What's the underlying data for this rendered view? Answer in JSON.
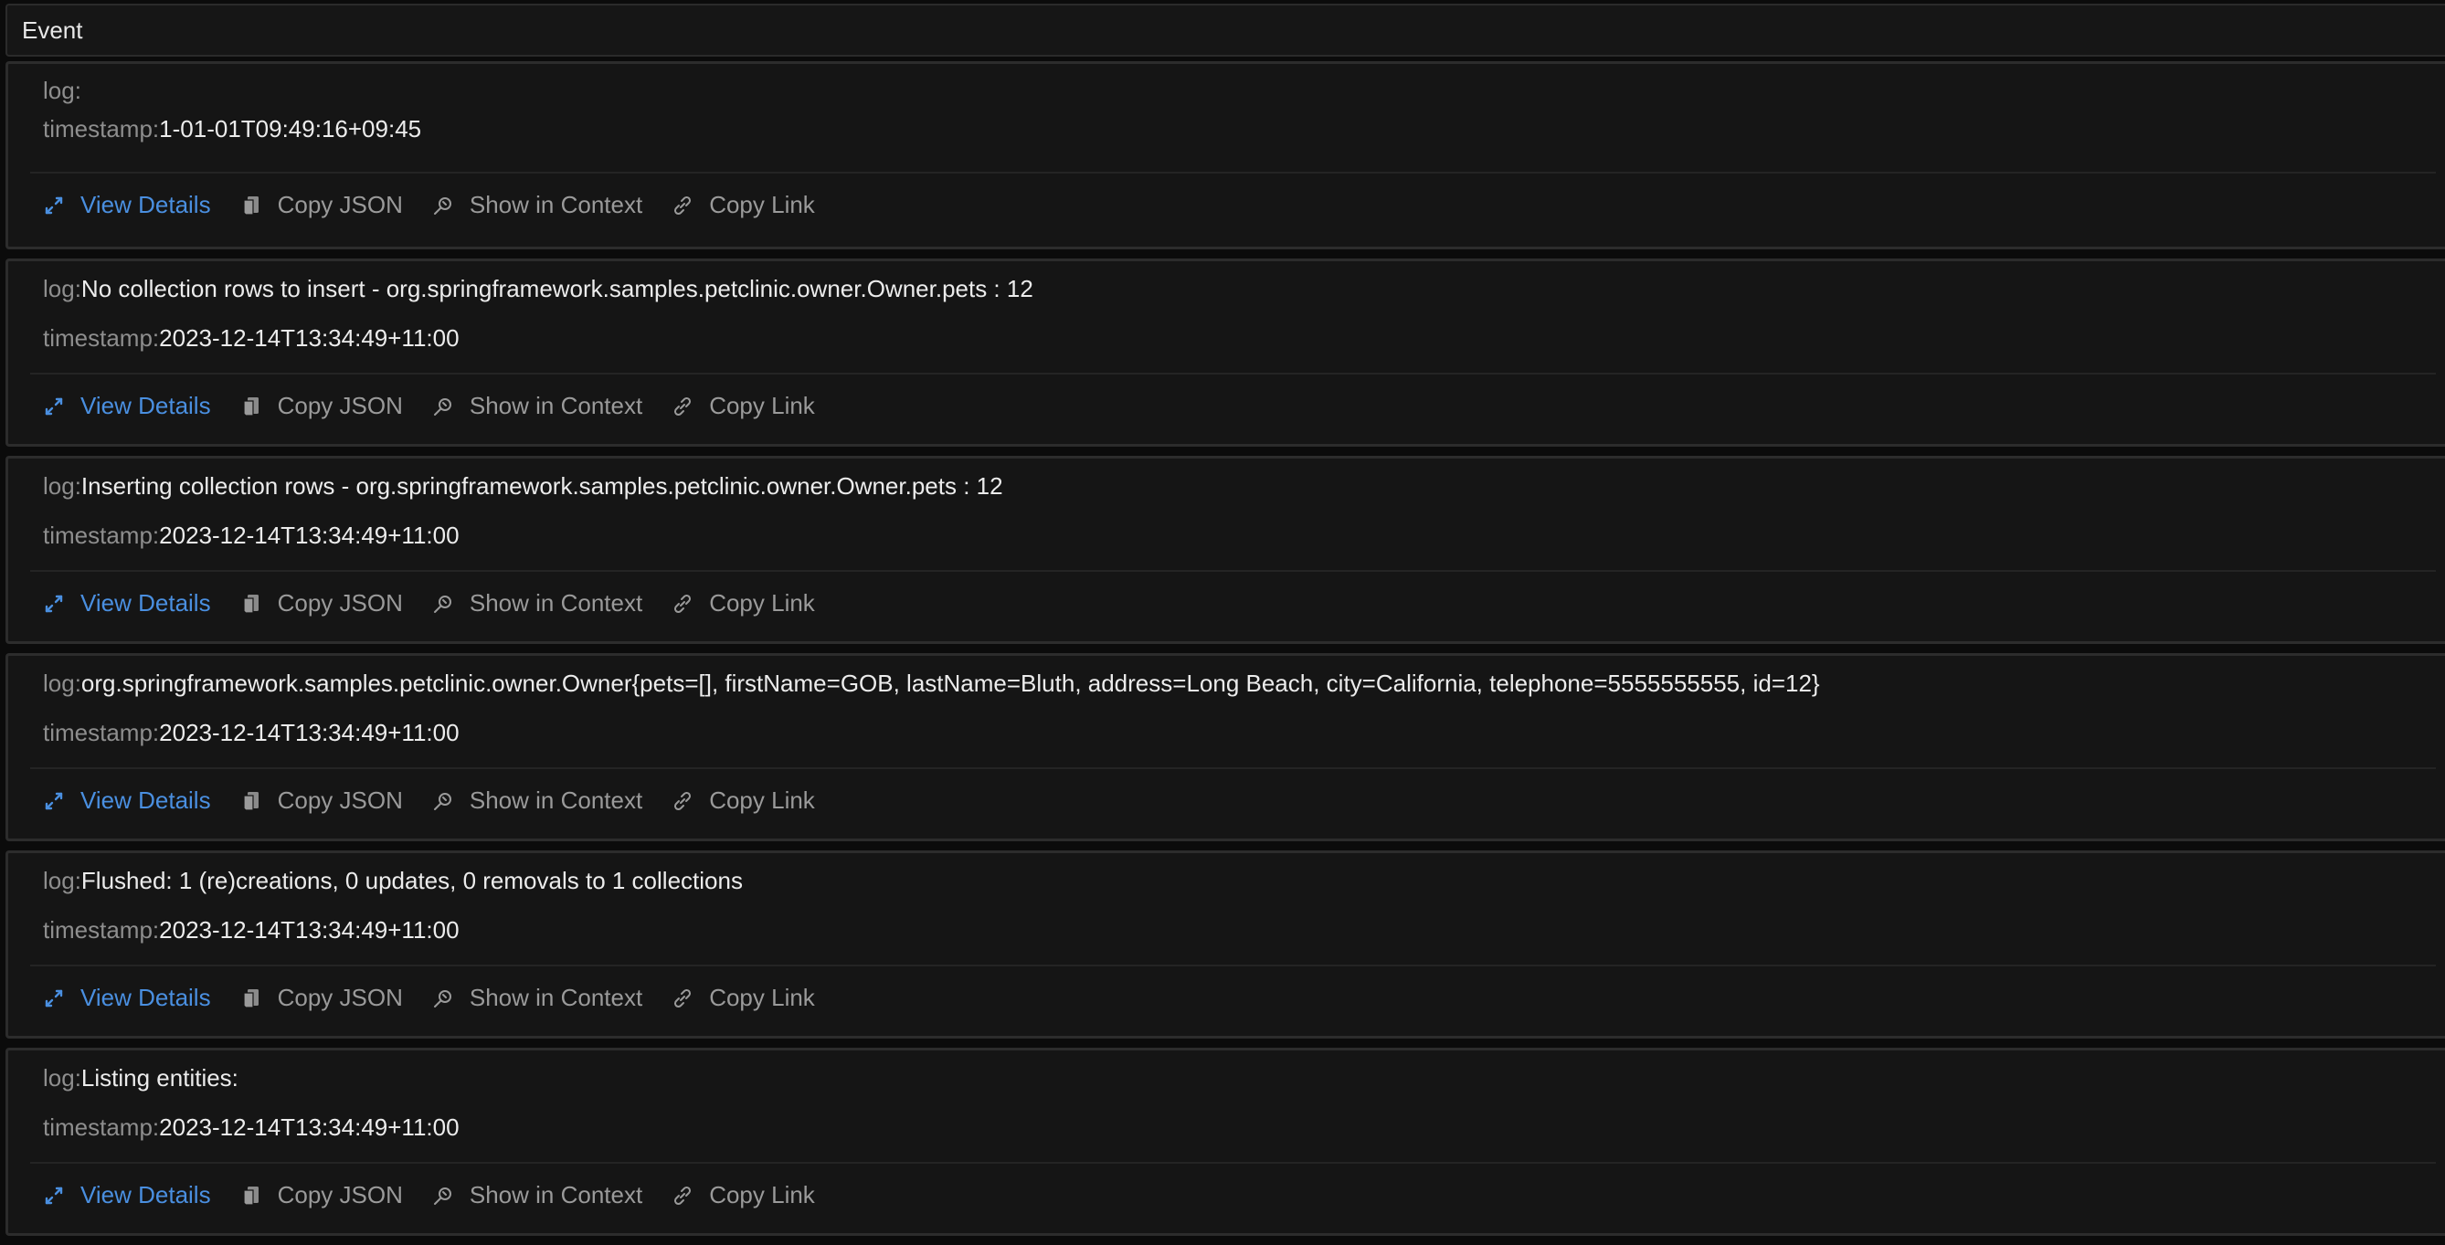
{
  "header": {
    "title": "Event"
  },
  "field_labels": {
    "log": "log:",
    "timestamp": "timestamp:"
  },
  "actions": [
    {
      "label": "View Details",
      "icon": "expand-icon"
    },
    {
      "label": "Copy JSON",
      "icon": "copy-icon"
    },
    {
      "label": "Show in Context",
      "icon": "search-context-icon"
    },
    {
      "label": "Copy Link",
      "icon": "link-icon"
    }
  ],
  "colors": {
    "accent": "#4a8fe0",
    "label": "#8e8e8e",
    "value": "#ececec",
    "background": "#151515"
  },
  "events": [
    {
      "log": "",
      "timestamp": "1-01-01T09:49:16+09:45"
    },
    {
      "log": "No collection rows to insert - org.springframework.samples.petclinic.owner.Owner.pets : 12",
      "timestamp": "2023-12-14T13:34:49+11:00"
    },
    {
      "log": "Inserting collection rows - org.springframework.samples.petclinic.owner.Owner.pets : 12",
      "timestamp": "2023-12-14T13:34:49+11:00"
    },
    {
      "log": "org.springframework.samples.petclinic.owner.Owner{pets=[], firstName=GOB, lastName=Bluth, address=Long Beach, city=California, telephone=5555555555, id=12}",
      "timestamp": "2023-12-14T13:34:49+11:00"
    },
    {
      "log": "Flushed: 1 (re)creations, 0 updates, 0 removals to 1 collections",
      "timestamp": "2023-12-14T13:34:49+11:00"
    },
    {
      "log": "Listing entities:",
      "timestamp": "2023-12-14T13:34:49+11:00"
    }
  ]
}
